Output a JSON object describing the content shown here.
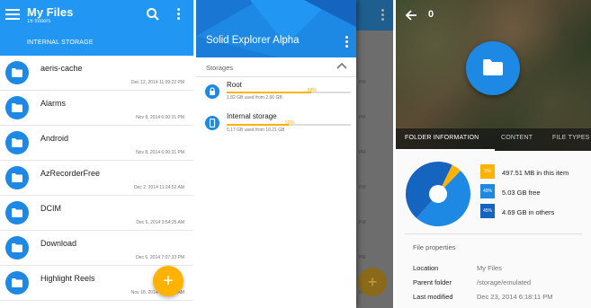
{
  "panel1": {
    "title": "My Files",
    "subtitle": "16 folders",
    "path": "INTERNAL STORAGE",
    "fab_label": "+",
    "items": [
      {
        "name": "aeris-cache",
        "date": "Dec 12, 2014 11:09:22 PM"
      },
      {
        "name": "Alarms",
        "date": "Nov 8, 2014 6:00:31 PM"
      },
      {
        "name": "Android",
        "date": "Nov 8, 2014 6:00:31 PM"
      },
      {
        "name": "AzRecorderFree",
        "date": "Dec 2, 2014 11:24:52 AM"
      },
      {
        "name": "DCIM",
        "date": "Dec 6, 2014 3:54:25 AM"
      },
      {
        "name": "Download",
        "date": "Dec 6, 2014 7:07:33 PM"
      },
      {
        "name": "Highlight Reels",
        "date": "Nov 18, 2014 12:38:22 AM"
      }
    ]
  },
  "panel2": {
    "title": "Solid Explorer Alpha",
    "section": "Storages",
    "storages": [
      {
        "name": "Root",
        "percent": "68%",
        "fraction": 0.68,
        "used": "1.82 GB used from 2.66 GB",
        "icon": "lock-icon"
      },
      {
        "name": "Internal storage",
        "percent": "50%",
        "fraction": 0.5,
        "used": "5.17 GB used from 10.21 GB",
        "icon": "phone-icon"
      }
    ],
    "dim_dates": [
      "PM",
      "PM",
      "PM",
      "PM",
      "PM",
      "PM",
      "PM"
    ],
    "dim_fab": "+"
  },
  "panel3": {
    "count": "0",
    "tabs": [
      "FOLDER INFORMATION",
      "CONTENT",
      "FILE TYPES"
    ],
    "legend": [
      {
        "pct": "5%",
        "text": "497.51 MB in this item",
        "color": "#ffb300"
      },
      {
        "pct": "49%",
        "text": "5.03 GB free",
        "color": "#1e88e5"
      },
      {
        "pct": "45%",
        "text": "4.69 GB in others",
        "color": "#1565c0"
      }
    ],
    "pie_fractions": [
      0.05,
      0.49,
      0.45
    ],
    "properties_title": "File properties",
    "properties": [
      {
        "key": "Location",
        "value": "My Files"
      },
      {
        "key": "Parent folder",
        "value": "/storage/emulated"
      },
      {
        "key": "Last modified",
        "value": "Dec 23, 2014 6:18:11 PM"
      }
    ]
  },
  "colors": {
    "primary": "#2196f3",
    "accent": "#ffb300",
    "folder": "#1e88e5"
  }
}
